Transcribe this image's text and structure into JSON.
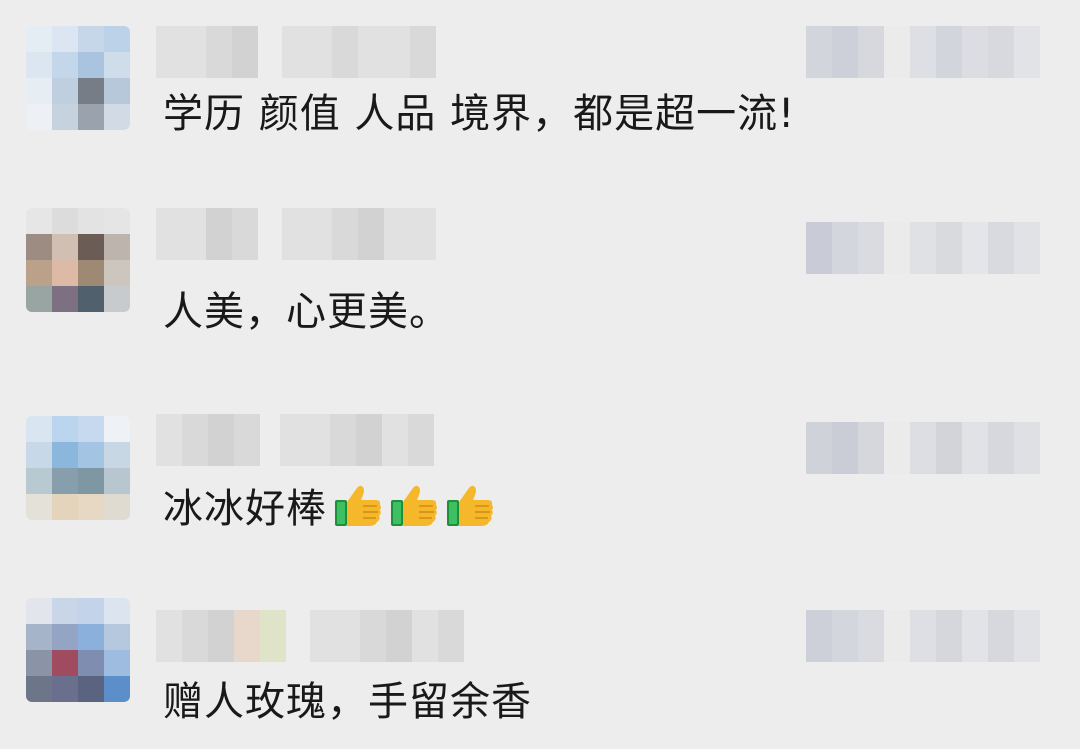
{
  "comments": [
    {
      "text": "学历 颜值 人品 境界，都是超一流!",
      "avatar_colors": [
        "#e4ecf4",
        "#dbe6f2",
        "#c6d7ea",
        "#bcd2e8",
        "#dbe6f0",
        "#c3d6ea",
        "#aac4e0",
        "#cfdcea",
        "#e6edf3",
        "#bfcfe0",
        "#767d87",
        "#b6c8da",
        "#edf1f5",
        "#c7d2df",
        "#9aa3ad",
        "#d2dbe5"
      ]
    },
    {
      "text": "人美，心更美。",
      "avatar_colors": [
        "#e6e6e6",
        "#dcdcdc",
        "#e3e3e3",
        "#e5e5e5",
        "#9c8c82",
        "#d2bfb3",
        "#6b5d55",
        "#bdb4ad",
        "#bba08a",
        "#dcbaa5",
        "#9e8a74",
        "#cdc6bf",
        "#99a5a2",
        "#7d7082",
        "#50606c",
        "#c8cbce"
      ]
    },
    {
      "text": "冰冰好棒",
      "thumbs_count": 3,
      "avatar_colors": [
        "#d9e6f1",
        "#bcd5ee",
        "#c6d9ef",
        "#eef2f6",
        "#c7d9e8",
        "#8cb7dd",
        "#a3c4e2",
        "#c8d7e4",
        "#b9c9d2",
        "#879fac",
        "#7f96a3",
        "#b8c6cf",
        "#e4e1d9",
        "#e3d4bb",
        "#e6d8c2",
        "#e0dbd1"
      ]
    },
    {
      "text": "赠人玫瑰，手留余香",
      "avatar_colors": [
        "#e2e6ec",
        "#c9d6e8",
        "#c3d3ea",
        "#dbe4ef",
        "#a6b4ca",
        "#93a4c4",
        "#8cb0dc",
        "#b6c8de",
        "#8b93a6",
        "#a04c60",
        "#7f8db0",
        "#9ebbe0",
        "#6d7688",
        "#696f8c",
        "#5a6480",
        "#5c8fca"
      ]
    }
  ]
}
